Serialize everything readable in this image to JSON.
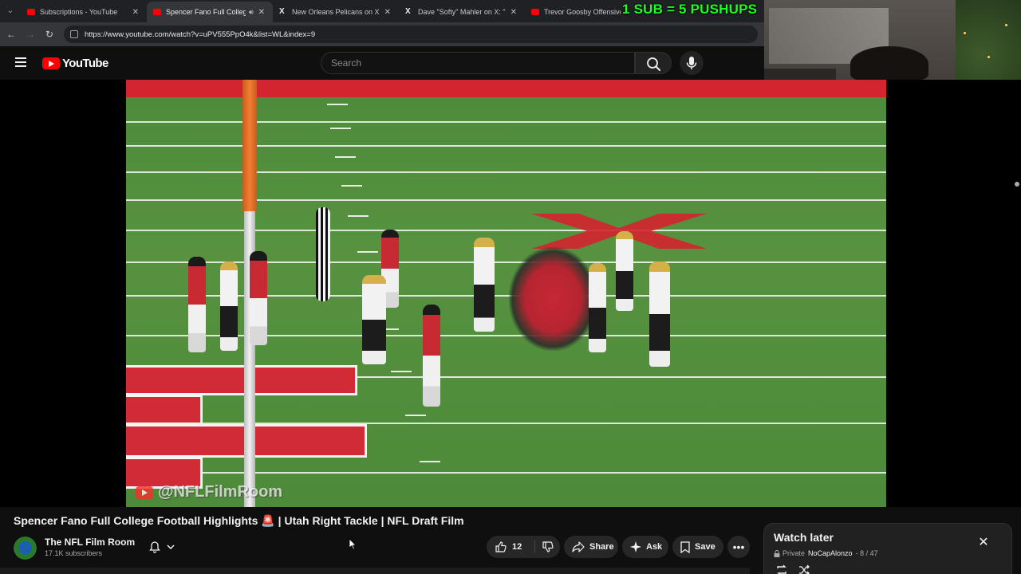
{
  "browser": {
    "tabs": [
      {
        "label": "Subscriptions - YouTube",
        "icon": "youtube-favicon"
      },
      {
        "label": "Spencer Fano Full College",
        "icon": "youtube-favicon",
        "active": true,
        "audio": true
      },
      {
        "label": "New Orleans Pelicans on X: \"Cl",
        "icon": "x-favicon"
      },
      {
        "label": "Dave \"Softy\" Mahler on X: \"FYI",
        "icon": "x-favicon"
      },
      {
        "label": "Trevor Goosby Offensive Tac",
        "icon": "youtube-favicon"
      }
    ],
    "url": "https://www.youtube.com/watch?v=uPV555PpO4k&list=WL&index=9"
  },
  "youtube": {
    "logo_text": "YouTube",
    "search_placeholder": "Search"
  },
  "overlay": {
    "banner": "1 SUB = 5 PUSHUPS"
  },
  "video": {
    "watermark": "@NFLFilmRoom",
    "title": "Spencer Fano Full College Football Highlights 🚨 | Utah Right Tackle | NFL Draft Film"
  },
  "channel": {
    "name": "The NFL Film Room",
    "subscribers": "17.1K subscribers"
  },
  "actions": {
    "like_count": "12",
    "share": "Share",
    "ask": "Ask",
    "save": "Save"
  },
  "watch_later": {
    "title": "Watch later",
    "privacy": "Private",
    "owner": "NoCapAlonzo",
    "position": "- 8 / 47"
  },
  "colors": {
    "brand_red": "#ff0000",
    "banner_green": "#1bff21",
    "background": "#0f0f0f"
  }
}
